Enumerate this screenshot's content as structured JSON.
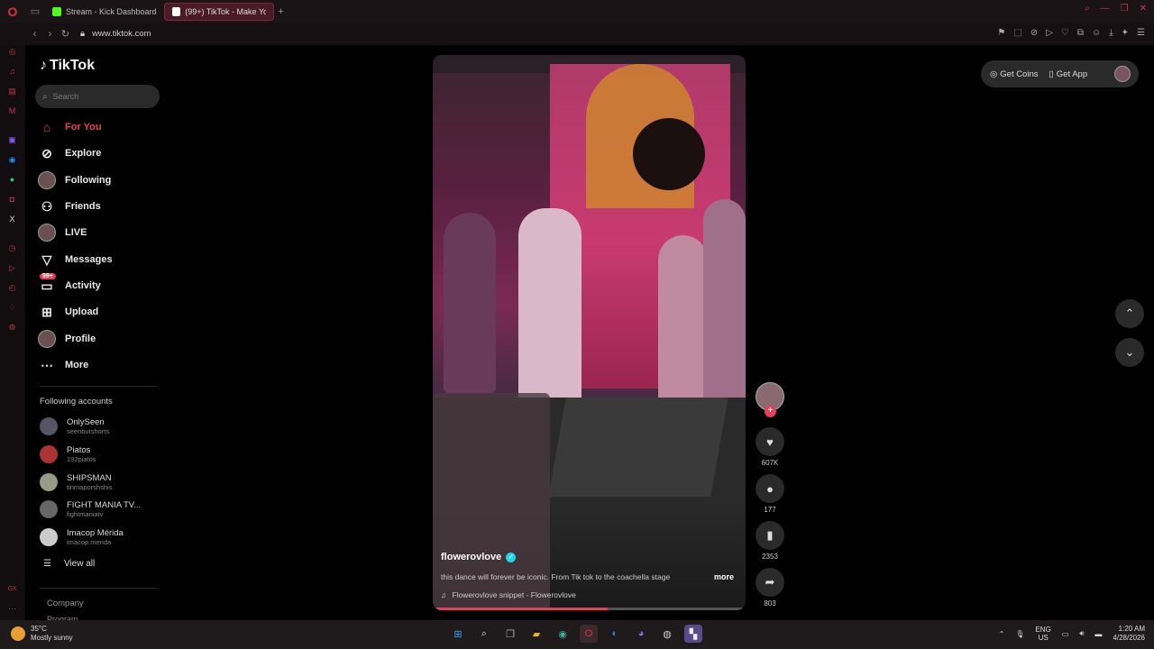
{
  "browser": {
    "tabs": [
      {
        "label": "Stream - Kick Dashboard",
        "fav_color": "#53fc18"
      },
      {
        "label": "(99+) TikTok - Make Yo",
        "fav_color": "#ffffff"
      }
    ],
    "url": "www.tiktok.com",
    "window_controls": [
      "search-icon",
      "minimize-icon",
      "maximize-icon",
      "close-icon"
    ]
  },
  "tiktok": {
    "logo": "TikTok",
    "search_placeholder": "Search",
    "nav": [
      {
        "label": "For You",
        "icon": "home-icon",
        "active": true
      },
      {
        "label": "Explore",
        "icon": "compass-icon"
      },
      {
        "label": "Following",
        "icon": "following-avatar"
      },
      {
        "label": "Friends",
        "icon": "friends-icon"
      },
      {
        "label": "LIVE",
        "icon": "live-avatar"
      },
      {
        "label": "Messages",
        "icon": "messages-icon"
      },
      {
        "label": "Activity",
        "icon": "activity-icon",
        "badge": "99+"
      },
      {
        "label": "Upload",
        "icon": "upload-icon"
      },
      {
        "label": "Profile",
        "icon": "profile-avatar"
      },
      {
        "label": "More",
        "icon": "more-icon"
      }
    ],
    "following_title": "Following accounts",
    "accounts": [
      {
        "name": "OnlySeen",
        "handle": "seenbutshorts"
      },
      {
        "name": "Piatos",
        "handle": "192piatos"
      },
      {
        "name": "SHIPSMAN",
        "handle": "tinmaporshshis"
      },
      {
        "name": "FIGHT MANIA TV...",
        "handle": "fightmaniatv"
      },
      {
        "name": "Imacop Mérida",
        "handle": "imacop.merida"
      }
    ],
    "view_all": "View all",
    "company": "Company",
    "program": "Program"
  },
  "video": {
    "username": "flowerovlove",
    "description": "this dance will forever be iconic. From Tik tok to the coachella stage",
    "more": "more",
    "music": "Flowerovlove snippet - Flowerovlove",
    "progress": 0.56,
    "likes": "607K",
    "comments": "177",
    "saves": "2353",
    "shares": "803"
  },
  "topright": {
    "coins": "Get Coins",
    "app": "Get App"
  },
  "taskbar": {
    "temp": "35°C",
    "weather": "Mostly sunny",
    "lang1": "ENG",
    "lang2": "US",
    "time": "1:20 AM",
    "date": "4/28/2026"
  }
}
